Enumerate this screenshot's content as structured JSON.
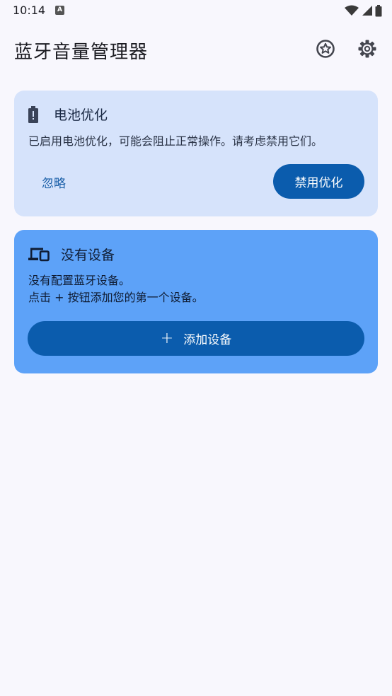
{
  "status_bar": {
    "time": "10:14",
    "notification_badge": "A"
  },
  "app_bar": {
    "title": "蓝牙音量管理器",
    "icons": [
      "star-icon",
      "gear-icon"
    ]
  },
  "battery_card": {
    "icon": "battery-icon",
    "title": "电池优化",
    "message": "已启用电池优化，可能会阻止正常操作。请考虑禁用它们。",
    "ignore_label": "忽略",
    "disable_label": "禁用优化"
  },
  "devices_card": {
    "icon": "devices-icon",
    "title": "没有设备",
    "line1": "没有配置蓝牙设备。",
    "line2": "点击 + 按钮添加您的第一个设备。",
    "add_plus": "+",
    "add_label": "添加设备"
  },
  "colors": {
    "background": "#f8f7fd",
    "battery_card": "#d6e3fb",
    "devices_card": "#5da2f8",
    "primary_button": "#0b5cad"
  }
}
